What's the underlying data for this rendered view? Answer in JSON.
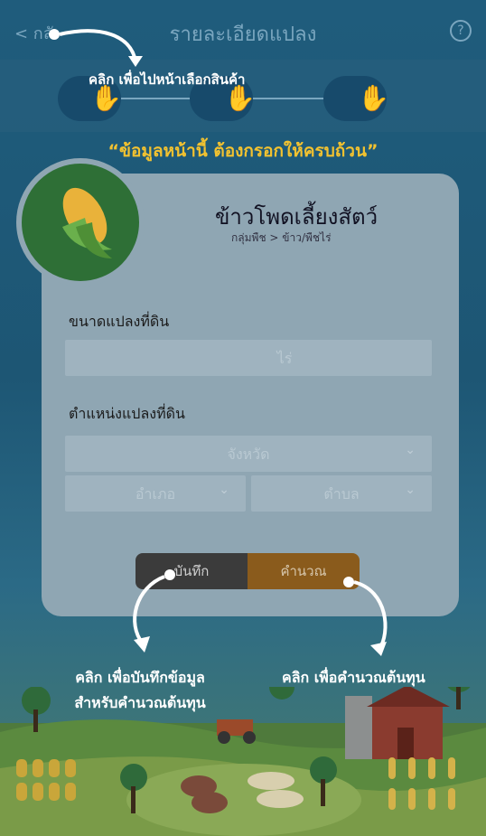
{
  "header": {
    "back_label": "< กลั",
    "title": "รายละเอียดแปลง",
    "help_icon": "question-circle-icon"
  },
  "steps": {
    "icons": [
      "hand-one-icon",
      "hand-two-icon",
      "hand-three-icon"
    ]
  },
  "tips": {
    "back_tip": "คลิก เพื่อไปหน้าเลือกสินค้า",
    "fill_all": "“ข้อมูลหน้านี้ ต้องกรอกให้ครบถ้วน”",
    "save_tip_line1": "คลิก เพื่อบันทึกข้อมูล",
    "save_tip_line2": "สำหรับคำนวณต้นทุน",
    "calc_tip": "คลิก เพื่อคำนวณต้นทุน"
  },
  "crop": {
    "name": "ข้าวโพดเลี้ยงสัตว์",
    "path": "กลุ่มพืช > ข้าว/พืชไร่",
    "icon": "corn-icon"
  },
  "form": {
    "plot_size_label": "ขนาดแปลงที่ดิน",
    "plot_size_placeholder": "ไร่",
    "location_label": "ตำแหน่งแปลงที่ดิน",
    "province_placeholder": "จังหวัด",
    "district_placeholder": "อำเภอ",
    "subdistrict_placeholder": "ตำบล"
  },
  "buttons": {
    "save": "บันทึก",
    "calculate": "คำนวณ"
  },
  "colors": {
    "accent_orange": "#8a5b1c",
    "quote_yellow": "#f2c230",
    "card": "#8fa6b3"
  }
}
